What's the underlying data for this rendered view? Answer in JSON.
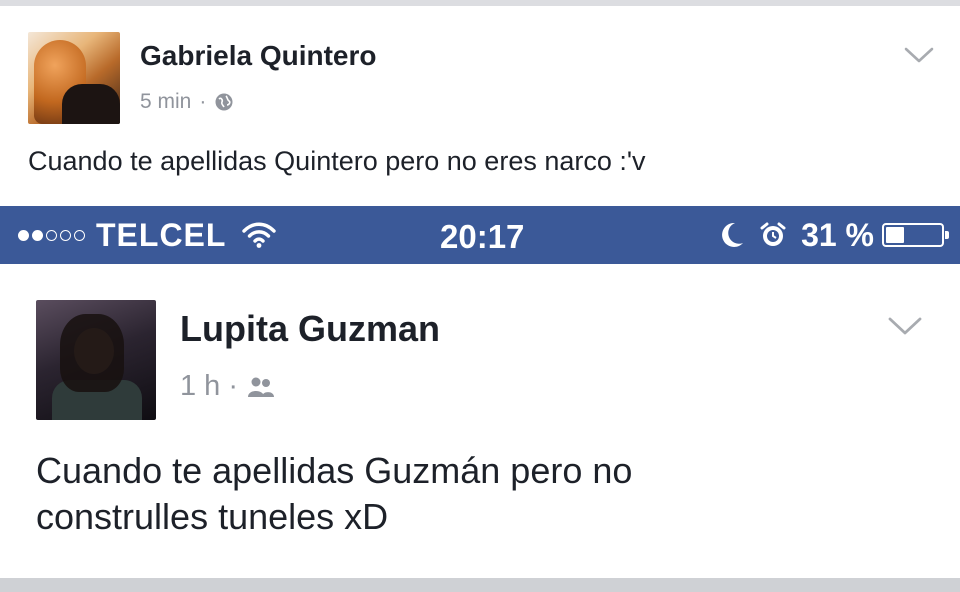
{
  "post1": {
    "author": "Gabriela Quintero",
    "time": "5 min",
    "separator": "·",
    "privacy_icon": "globe-icon",
    "text": "Cuando te apellidas Quintero pero no eres narco :'v"
  },
  "status_bar": {
    "signal_full": 2,
    "signal_total": 5,
    "carrier": "TELCEL",
    "time": "20:17",
    "battery_level": "31 %",
    "battery_fraction": 0.31,
    "icons": [
      "wifi-icon",
      "moon-icon",
      "alarm-icon",
      "battery-icon"
    ]
  },
  "post2": {
    "author": "Lupita Guzman",
    "time": "1 h",
    "separator": "·",
    "privacy_icon": "friends-icon",
    "text_line1": "Cuando te apellidas Guzmán pero no",
    "text_line2": "construlles tuneles xD"
  },
  "colors": {
    "status_bar_bg": "#3b5998",
    "name_text": "#1d2129",
    "meta_text": "#90949c"
  }
}
